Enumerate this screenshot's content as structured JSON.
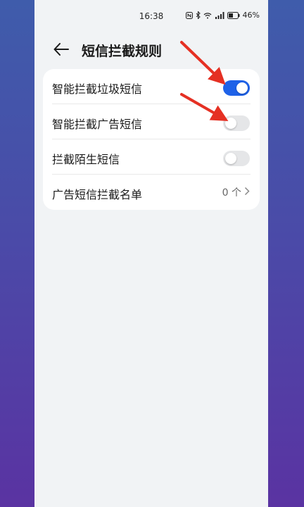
{
  "status_bar": {
    "time": "16:38",
    "battery": "46%"
  },
  "header": {
    "title": "短信拦截规则"
  },
  "settings": [
    {
      "label": "智能拦截垃圾短信",
      "type": "toggle",
      "on": true
    },
    {
      "label": "智能拦截广告短信",
      "type": "toggle",
      "on": false
    },
    {
      "label": "拦截陌生短信",
      "type": "toggle",
      "on": false
    },
    {
      "label": "广告短信拦截名单",
      "type": "link",
      "value": "0 个"
    }
  ],
  "colors": {
    "toggle_on": "#1f62e8",
    "toggle_off": "#e5e6e8",
    "annotation_arrow": "#e53023"
  },
  "icons": {
    "back": "arrow-left-icon",
    "chevron": "chevron-right-icon"
  }
}
